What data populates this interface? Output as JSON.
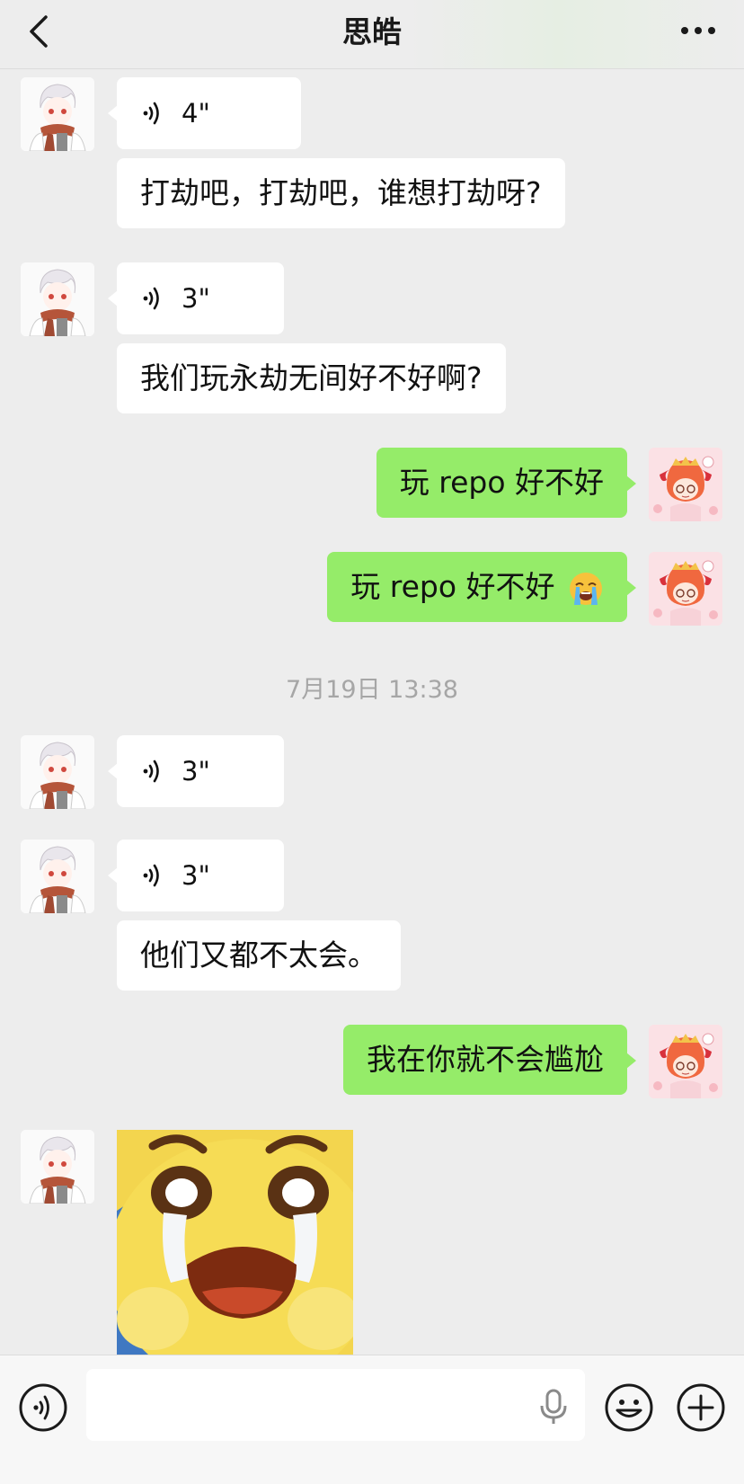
{
  "header": {
    "title": "思皓"
  },
  "messages": {
    "m1": {
      "duration": "4\""
    },
    "m2": {
      "text": "打劫吧，打劫吧，谁想打劫呀?"
    },
    "m3": {
      "duration": "3\""
    },
    "m4": {
      "text": "我们玩永劫无间好不好啊?"
    },
    "m5": {
      "text": "玩 repo 好不好"
    },
    "m6": {
      "text": "玩 repo 好不好"
    },
    "timestamp": "7月19日 13:38",
    "m7": {
      "duration": "3\""
    },
    "m8": {
      "duration": "3\""
    },
    "m9": {
      "text": "他们又都不太会。"
    },
    "m10": {
      "text": "我在你就不会尴尬"
    }
  },
  "input": {
    "value": "",
    "placeholder": ""
  },
  "colors": {
    "outgoing_bubble": "#95ec69",
    "incoming_bubble": "#ffffff",
    "background": "#ededed",
    "timestamp_text": "#a6a6a6"
  },
  "icons": {
    "back": "chevron-left-icon",
    "more": "more-dots-icon",
    "voice": "voice-wave-icon",
    "mic": "microphone-icon",
    "emoji": "smile-icon",
    "plus": "plus-icon",
    "sob_emoji": "loudly-crying-face-emoji"
  }
}
